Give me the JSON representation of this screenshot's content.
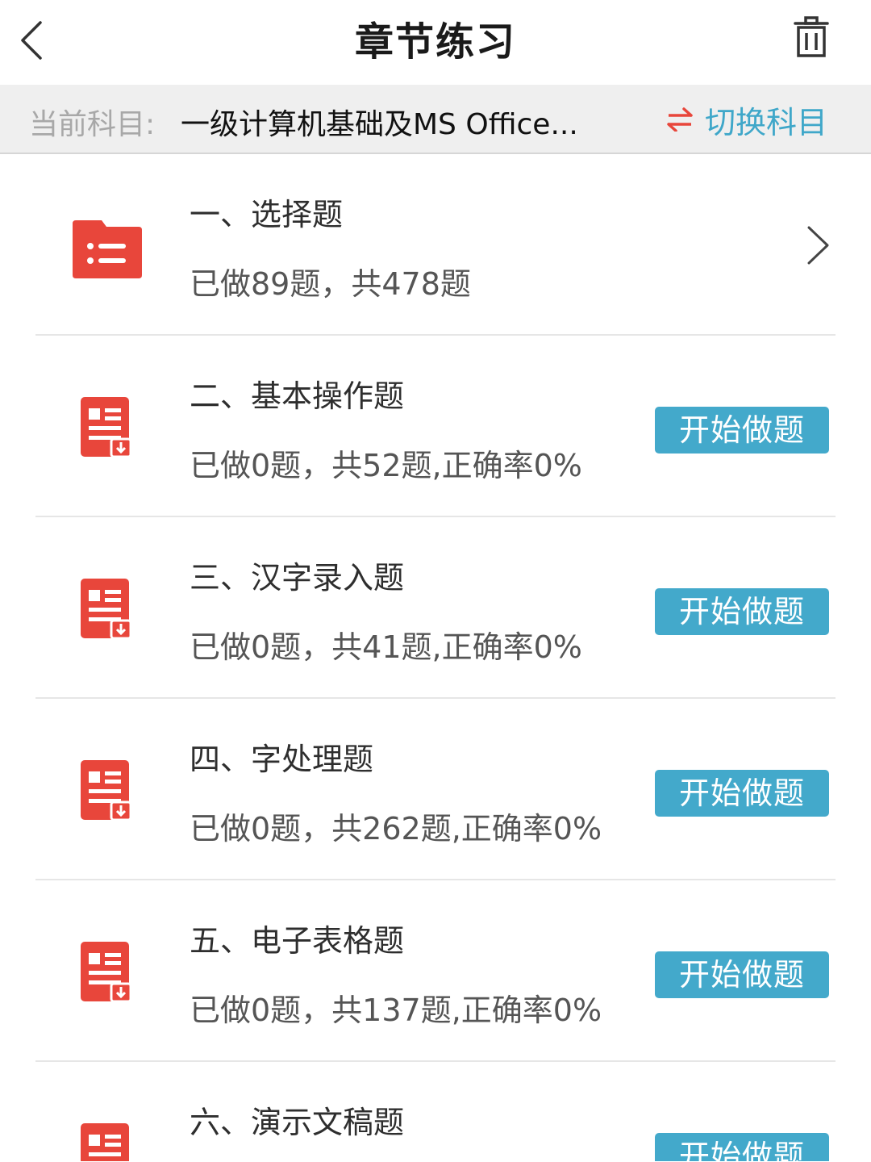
{
  "header": {
    "title": "章节练习",
    "back_icon": "chevron-left-icon",
    "trash_icon": "trash-icon"
  },
  "subject": {
    "label": "当前科目:",
    "name": "一级计算机基础及MS Office...",
    "switch_icon": "swap-arrows-icon",
    "switch_label": "切换科目"
  },
  "colors": {
    "accent": "#43a9cb",
    "icon_red": "#e8463b",
    "bar_bg": "#efefef"
  },
  "chapters": [
    {
      "title": "一、选择题",
      "stats": "已做89题，共478题",
      "icon": "folder-list-icon",
      "action": "chevron-right-icon"
    },
    {
      "title": "二、基本操作题",
      "stats": "已做0题，共52题,正确率0%",
      "icon": "document-download-icon",
      "button": "开始做题"
    },
    {
      "title": "三、汉字录入题",
      "stats": "已做0题，共41题,正确率0%",
      "icon": "document-download-icon",
      "button": "开始做题"
    },
    {
      "title": "四、字处理题",
      "stats": "已做0题，共262题,正确率0%",
      "icon": "document-download-icon",
      "button": "开始做题"
    },
    {
      "title": "五、电子表格题",
      "stats": "已做0题，共137题,正确率0%",
      "icon": "document-download-icon",
      "button": "开始做题"
    },
    {
      "title": "六、演示文稿题",
      "icon": "document-download-icon",
      "button": "开始做题"
    }
  ]
}
